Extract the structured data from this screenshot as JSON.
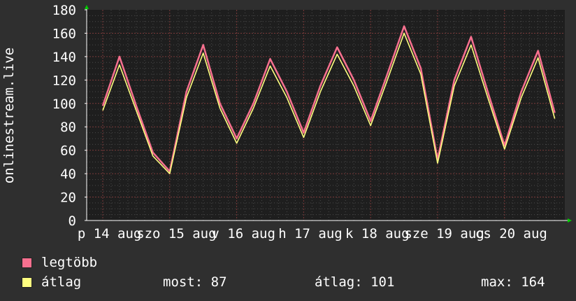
{
  "chart_data": {
    "type": "line",
    "ylabel": "onlinestream.live",
    "ylim": [
      0,
      180
    ],
    "yticks": [
      0,
      20,
      40,
      60,
      80,
      100,
      120,
      140,
      160,
      180
    ],
    "grid": true,
    "xtick_labels": [
      "p 14 aug",
      "szo 15 aug",
      "v 16 aug",
      "h 17 aug",
      "k 18 aug",
      "sze 19 aug",
      "cs 20 aug"
    ],
    "x": [
      0.0,
      0.25,
      0.5,
      0.75,
      1.0,
      1.25,
      1.5,
      1.75,
      2.0,
      2.25,
      2.5,
      2.75,
      3.0,
      3.25,
      3.5,
      3.75,
      4.0,
      4.25,
      4.5,
      4.75,
      5.0,
      5.25,
      5.5,
      5.75,
      6.0,
      6.25,
      6.5,
      6.75
    ],
    "series": [
      {
        "name": "legtöbb",
        "color": "#f7708f",
        "values": [
          98,
          140,
          98,
          58,
          42,
          110,
          150,
          100,
          70,
          100,
          138,
          110,
          75,
          115,
          148,
          120,
          85,
          125,
          166,
          130,
          52,
          120,
          157,
          110,
          64,
          110,
          145,
          92
        ]
      },
      {
        "name": "átlag",
        "color": "#ffff80",
        "values": [
          94,
          133,
          94,
          55,
          40,
          105,
          143,
          96,
          66,
          96,
          132,
          105,
          71,
          110,
          142,
          115,
          81,
          120,
          160,
          125,
          49,
          115,
          150,
          105,
          61,
          105,
          139,
          87
        ]
      }
    ]
  },
  "legend": {
    "max_label": "legtöbb",
    "avg_label": "átlag"
  },
  "stats": {
    "now": "most: 87",
    "avg": "átlag: 101",
    "max": "max: 164"
  }
}
